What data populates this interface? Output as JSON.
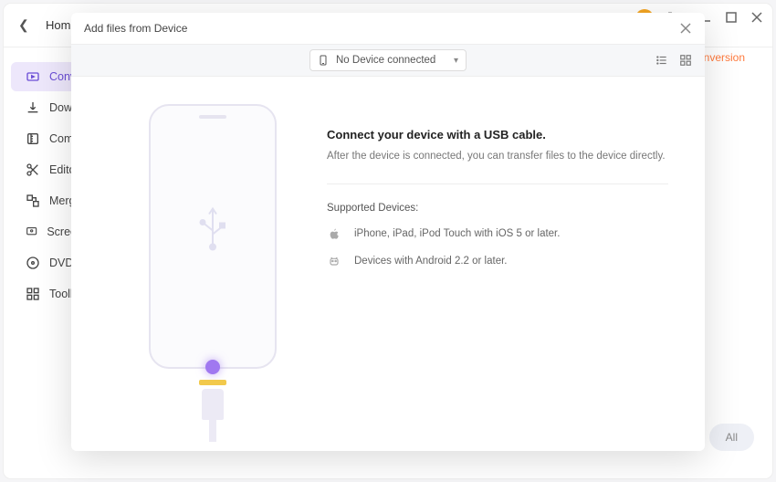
{
  "window": {
    "home_label": "Home"
  },
  "sidebar": {
    "items": [
      {
        "label": "Converter"
      },
      {
        "label": "Downloader"
      },
      {
        "label": "Compressor"
      },
      {
        "label": "Editor"
      },
      {
        "label": "Merger"
      },
      {
        "label": "Screen Recorder"
      },
      {
        "label": "DVD Burner"
      },
      {
        "label": "Toolbox"
      }
    ]
  },
  "header": {
    "conversion_badge": "nversion"
  },
  "footer": {
    "convert_all": "All"
  },
  "modal": {
    "title": "Add files from Device",
    "device_selector": "No Device connected",
    "info_title": "Connect your device with a USB cable.",
    "info_sub": "After the device is connected, you can transfer files to the device directly.",
    "supported_title": "Supported Devices:",
    "supported": [
      "iPhone, iPad, iPod Touch with iOS 5 or later.",
      "Devices with Android 2.2 or later."
    ]
  }
}
